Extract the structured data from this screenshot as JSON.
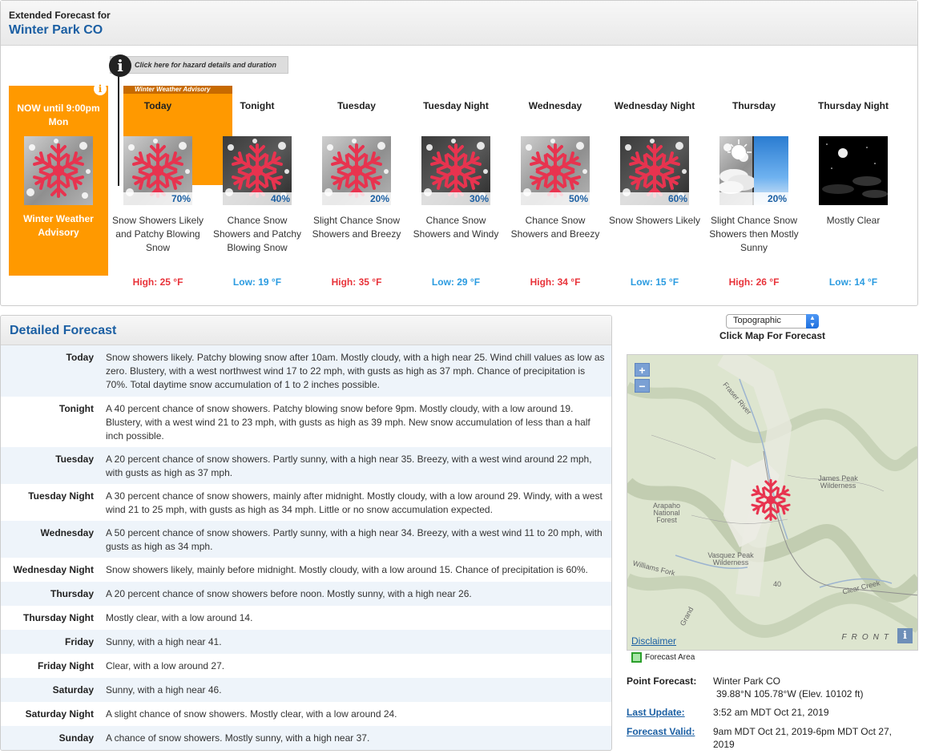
{
  "header": {
    "subtitle": "Extended Forecast for",
    "location": "Winter Park CO"
  },
  "hazard": {
    "link_text": "Click here for hazard details and duration",
    "now_title": "NOW until 9:00pm Mon",
    "now_label": "Winter Weather Advisory",
    "advisory_tab": "Winter Weather Advisory",
    "color": "#ff9900"
  },
  "periods": [
    {
      "name": "Today",
      "pop": "70%",
      "short": "Snow Showers Likely and Patchy Blowing Snow",
      "temp": "High: 25 °F",
      "kind": "high",
      "icon": "snow-light-icon"
    },
    {
      "name": "Tonight",
      "pop": "40%",
      "short": "Chance Snow Showers and Patchy Blowing Snow",
      "temp": "Low: 19 °F",
      "kind": "low",
      "icon": "snow-night-icon"
    },
    {
      "name": "Tuesday",
      "pop": "20%",
      "short": "Slight Chance Snow Showers and Breezy",
      "temp": "High: 35 °F",
      "kind": "high",
      "icon": "snow-light-icon"
    },
    {
      "name": "Tuesday Night",
      "pop": "30%",
      "short": "Chance Snow Showers and Windy",
      "temp": "Low: 29 °F",
      "kind": "low",
      "icon": "snow-night-icon"
    },
    {
      "name": "Wednesday",
      "pop": "50%",
      "short": "Chance Snow Showers and Breezy",
      "temp": "High: 34 °F",
      "kind": "high",
      "icon": "snow-light-icon"
    },
    {
      "name": "Wednesday Night",
      "pop": "60%",
      "short": "Snow Showers Likely",
      "temp": "Low: 15 °F",
      "kind": "low",
      "icon": "snow-night-icon"
    },
    {
      "name": "Thursday",
      "pop": "20%",
      "short": "Slight Chance Snow Showers then Mostly Sunny",
      "temp": "High: 26 °F",
      "kind": "high",
      "icon": "snow-then-sunny-icon"
    },
    {
      "name": "Thursday Night",
      "pop": "",
      "short": "Mostly Clear",
      "temp": "Low: 14 °F",
      "kind": "low",
      "icon": "clear-night-icon"
    }
  ],
  "detailed": {
    "title": "Detailed Forecast",
    "rows": [
      {
        "label": "Today",
        "text": "Snow showers likely. Patchy blowing snow after 10am. Mostly cloudy, with a high near 25. Wind chill values as low as zero. Blustery, with a west northwest wind 17 to 22 mph, with gusts as high as 37 mph. Chance of precipitation is 70%. Total daytime snow accumulation of 1 to 2 inches possible."
      },
      {
        "label": "Tonight",
        "text": "A 40 percent chance of snow showers. Patchy blowing snow before 9pm. Mostly cloudy, with a low around 19. Blustery, with a west wind 21 to 23 mph, with gusts as high as 39 mph. New snow accumulation of less than a half inch possible."
      },
      {
        "label": "Tuesday",
        "text": "A 20 percent chance of snow showers. Partly sunny, with a high near 35. Breezy, with a west wind around 22 mph, with gusts as high as 37 mph."
      },
      {
        "label": "Tuesday Night",
        "text": "A 30 percent chance of snow showers, mainly after midnight. Mostly cloudy, with a low around 29. Windy, with a west wind 21 to 25 mph, with gusts as high as 34 mph. Little or no snow accumulation expected."
      },
      {
        "label": "Wednesday",
        "text": "A 50 percent chance of snow showers. Partly sunny, with a high near 34. Breezy, with a west wind 11 to 20 mph, with gusts as high as 34 mph."
      },
      {
        "label": "Wednesday Night",
        "text": "Snow showers likely, mainly before midnight. Mostly cloudy, with a low around 15. Chance of precipitation is 60%."
      },
      {
        "label": "Thursday",
        "text": "A 20 percent chance of snow showers before noon. Mostly sunny, with a high near 26."
      },
      {
        "label": "Thursday Night",
        "text": "Mostly clear, with a low around 14."
      },
      {
        "label": "Friday",
        "text": "Sunny, with a high near 41."
      },
      {
        "label": "Friday Night",
        "text": "Clear, with a low around 27."
      },
      {
        "label": "Saturday",
        "text": "Sunny, with a high near 46."
      },
      {
        "label": "Saturday Night",
        "text": "A slight chance of snow showers. Mostly clear, with a low around 24."
      },
      {
        "label": "Sunday",
        "text": "A chance of snow showers. Mostly sunny, with a high near 37."
      }
    ]
  },
  "map": {
    "select_value": "Topographic",
    "caption": "Click Map For Forecast",
    "zoom_in": "+",
    "zoom_out": "−",
    "disclaimer": "Disclaimer",
    "front_label": "FRONT",
    "labels": {
      "fraser_river": "Fraser River",
      "james_peak": "James Peak Wilderness",
      "arapaho": "Arapaho National Forest",
      "vasquez": "Vasquez Peak Wilderness",
      "williams_fork": "Williams Fork",
      "clear_creek": "Clear Creek",
      "hwy": "40",
      "grand": "Grand"
    },
    "legend": "Forecast Area"
  },
  "point_forecast": {
    "label": "Point Forecast:",
    "place": "Winter Park CO",
    "coords": "39.88°N 105.78°W (Elev. 10102 ft)",
    "last_update_label": "Last Update:",
    "last_update": "3:52 am MDT Oct 21, 2019",
    "valid_label": "Forecast Valid:",
    "valid": "9am MDT Oct 21, 2019-6pm MDT Oct 27, 2019"
  },
  "colors": {
    "high": "#e8333a",
    "low": "#2b9be0",
    "link": "#1b5fa3",
    "snowflake": "#e8334f"
  }
}
